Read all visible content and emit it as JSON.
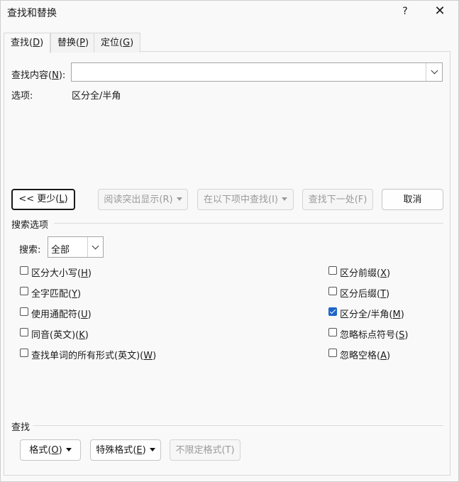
{
  "window": {
    "title": "查找和替换",
    "help": "?",
    "close": "✕"
  },
  "tabs": [
    {
      "text": "查找",
      "key": "D"
    },
    {
      "text": "替换",
      "key": "P"
    },
    {
      "text": "定位",
      "key": "G"
    }
  ],
  "find": {
    "label_text": "查找内容",
    "label_key": "N",
    "value": "",
    "placeholder": ""
  },
  "options_line": {
    "label": "选项:",
    "value": "区分全/半角"
  },
  "buttons": {
    "less": {
      "prefix": "<< 更少",
      "key": "L"
    },
    "highlight": "阅读突出显示(R)",
    "find_in": "在以下项中查找(I)",
    "find_next": "查找下一处(F)",
    "cancel": "取消"
  },
  "search_options": {
    "title": "搜索选项",
    "search_label": "搜索",
    "search_key": "",
    "search_value": "全部",
    "left": [
      {
        "text": "区分大小写",
        "key": "H",
        "checked": false
      },
      {
        "text": "全字匹配",
        "key": "Y",
        "checked": false
      },
      {
        "text": "使用通配符",
        "key": "U",
        "checked": false
      },
      {
        "text": "同音(英文)",
        "key": "K",
        "checked": false
      },
      {
        "text": "查找单词的所有形式(英文)",
        "key": "W",
        "checked": false
      }
    ],
    "right": [
      {
        "text": "区分前缀",
        "key": "X",
        "checked": false
      },
      {
        "text": "区分后缀",
        "key": "T",
        "checked": false
      },
      {
        "text": "区分全/半角",
        "key": "M",
        "checked": true
      },
      {
        "text": "忽略标点符号",
        "key": "S",
        "checked": false
      },
      {
        "text": "忽略空格",
        "key": "A",
        "checked": false
      }
    ]
  },
  "find_section": {
    "title": "查找",
    "format": {
      "text": "格式",
      "key": "O"
    },
    "special": {
      "text": "特殊格式",
      "key": "E"
    },
    "no_format": "不限定格式(T)"
  },
  "colors": {
    "accent": "#1e64c8",
    "checkbox_checked": "#1e64c8"
  }
}
